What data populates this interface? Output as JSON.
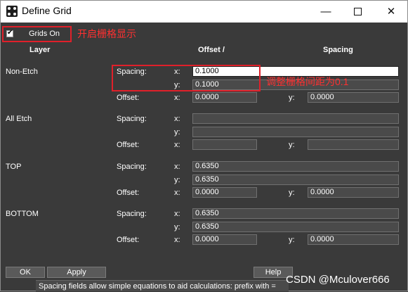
{
  "window": {
    "title": "Define Grid",
    "minimize_glyph": "—",
    "close_glyph": "✕"
  },
  "toolbar": {
    "grids_on_label": "Grids On",
    "grids_on_checked": true,
    "annotation_grids": "开启栅格显示"
  },
  "headers": {
    "layer": "Layer",
    "offset": "Offset  /",
    "spacing": "Spacing"
  },
  "field_labels": {
    "spacing": "Spacing:",
    "offset": "Offset:",
    "x": "x:",
    "y": "y:"
  },
  "layers": [
    {
      "name": "Non-Etch",
      "spacing_x": "0.1000",
      "spacing_y": "0.1000",
      "offset_x": "0.0000",
      "offset_y": "0.0000"
    },
    {
      "name": "All Etch",
      "spacing_x": "",
      "spacing_y": "",
      "offset_x": "",
      "offset_y": ""
    },
    {
      "name": "TOP",
      "spacing_x": "0.6350",
      "spacing_y": "0.6350",
      "offset_x": "0.0000",
      "offset_y": "0.0000"
    },
    {
      "name": "BOTTOM",
      "spacing_x": "0.6350",
      "spacing_y": "0.6350",
      "offset_x": "0.0000",
      "offset_y": "0.0000"
    }
  ],
  "annotation_spacing": "调整栅格间距为0.1",
  "buttons": {
    "ok": "OK",
    "apply": "Apply",
    "help": "Help"
  },
  "status": "Spacing fields allow simple equations to aid calculations: prefix with =",
  "watermark": "CSDN @Mculover666",
  "colors": {
    "annotation_red": "#e0202a",
    "background": "#3a3a3a"
  }
}
